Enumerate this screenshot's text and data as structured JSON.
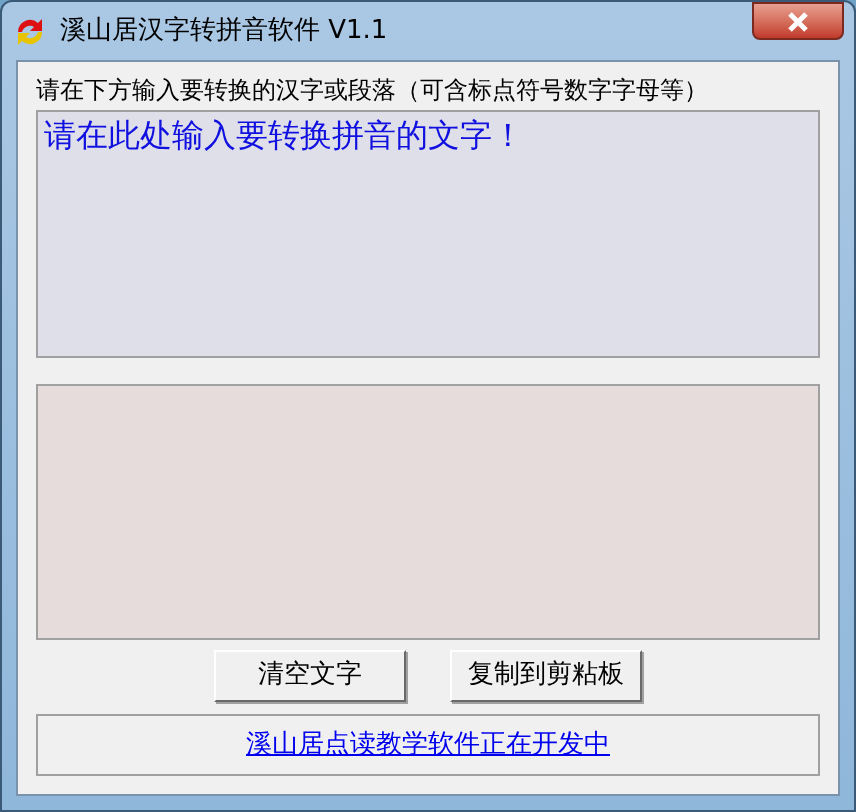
{
  "window": {
    "title": "溪山居汉字转拼音软件 V1.1"
  },
  "instruction": "请在下方输入要转换的汉字或段落（可含标点符号数字字母等）",
  "input": {
    "value": "请在此处输入要转换拼音的文字！"
  },
  "buttons": [
    "清空文字",
    "复制到剪粘板"
  ],
  "link": "溪山居点读教学软件正在开发中"
}
